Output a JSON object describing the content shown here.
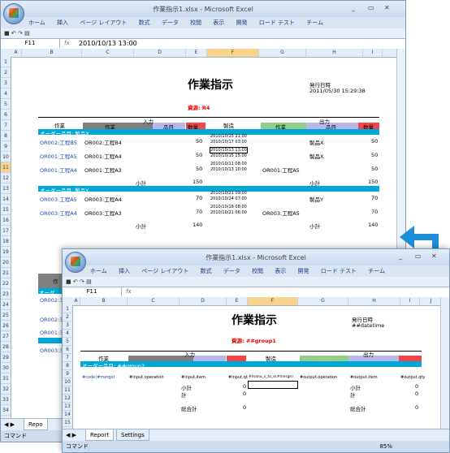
{
  "back": {
    "title": "作業指示1.xlsx - Microsoft Excel",
    "ribbon_tabs": [
      "ホーム",
      "挿入",
      "ページ レイアウト",
      "数式",
      "データ",
      "校閲",
      "表示",
      "開発",
      "ロード テスト",
      "チーム"
    ],
    "namebox": "F11",
    "formula": "2010/10/13 13:00",
    "columns": [
      "A",
      "B",
      "C",
      "D",
      "E",
      "F",
      "G",
      "H",
      "I"
    ],
    "rows": [
      "1",
      "2",
      "3",
      "4",
      "5",
      "6",
      "7",
      "8",
      "9",
      "10",
      "11",
      "12",
      "13",
      "14",
      "15",
      "16",
      "17",
      "18",
      "19",
      "20",
      "21",
      "22",
      "23",
      "24",
      "25",
      "26",
      "27",
      "28",
      "29",
      "30",
      "31",
      "32",
      "33",
      "34"
    ],
    "doc_title": "作業指示",
    "issue_label": "発行日時",
    "issue_value": "2011/05/30 15:29:38",
    "resource": "資源: R4",
    "hdr_work": "作業",
    "hdr_input": "入力",
    "hdr_make": "製造",
    "hdr_output": "出力",
    "sub_work": "作業",
    "sub_item": "品目",
    "sub_qty": "数量",
    "group1": "オーダー品目: 製品X",
    "group2": "オーダー品目: 製品Y",
    "rows_data": [
      {
        "op": "OR002:工程B5",
        "in": "OR002:工程B4",
        "qty": "50",
        "t1": "2010/10/15 21:00",
        "t2": "2010/10/17 03:00",
        "outop": "",
        "out": "製品X",
        "oqty": "50"
      },
      {
        "op": "OR001:工程A5",
        "in": "OR001:工程A4",
        "qty": "50",
        "t1": "2010/10/13 13:00",
        "t2": "2010/10/15 15:00",
        "outop": "",
        "out": "製品X",
        "oqty": "50"
      },
      {
        "op": "OR001:工程A4",
        "in": "OR001:工程A3",
        "qty": "50",
        "t1": "2010/10/11 08:00",
        "t2": "2010/10/13 10:00",
        "outop": "OR001:工程A5",
        "out": "",
        "oqty": "50"
      }
    ],
    "subtotal1_label": "小計",
    "subtotal1": "150",
    "subtotal1_out": "150",
    "rows_data2": [
      {
        "op": "OR003:工程A5",
        "in": "OR003:工程A4",
        "qty": "70",
        "t1": "2010/10/21 09:00",
        "t2": "2010/10/24 07:00",
        "outop": "",
        "out": "製品Y",
        "oqty": "70"
      },
      {
        "op": "OR003:工程A4",
        "in": "OR003:工程A3",
        "qty": "70",
        "t1": "2010/10/18 08:00",
        "t2": "2010/10/21 06:00",
        "outop": "OR003:工程A5",
        "out": "",
        "oqty": "70"
      }
    ],
    "subtotal2": "140",
    "subtotal2_out": "140",
    "partial_left": [
      "OR002:3",
      "OR002:3",
      "OR001:3",
      "OR003:3"
    ],
    "partial_work": "作",
    "partial_order": "オーダ",
    "tab": "Repo",
    "status": "コマンド"
  },
  "front": {
    "title": "作業指示1.xlsx - Microsoft Excel",
    "ribbon_tabs": [
      "ホーム",
      "挿入",
      "ページ レイアウト",
      "数式",
      "データ",
      "校閲",
      "表示",
      "開発",
      "ロード テスト",
      "チーム"
    ],
    "namebox": "F11",
    "columns": [
      "A",
      "B",
      "C",
      "D",
      "E",
      "F",
      "G",
      "H",
      "I",
      "J"
    ],
    "rows": [
      "1",
      "2",
      "3",
      "4",
      "5",
      "6",
      "7",
      "8",
      "9",
      "10",
      "11",
      "12",
      "13",
      "14",
      "15"
    ],
    "doc_title": "作業指示",
    "issue_label": "発行日時",
    "issue_value": "##datetime",
    "resource": "資源: ##group1",
    "hdr_work": "作業",
    "hdr_input": "入力",
    "hdr_make": "製造",
    "hdr_output": "出力",
    "group": "オーダー品目: ##group2",
    "r10": [
      "#code(#merge)",
      "#input.operation",
      "#input.item",
      "#input.qty",
      "#manu_s_to_e(#merge)",
      "#output.operation",
      "#output.item",
      "#output.qty"
    ],
    "subtotal": "小計",
    "total": "計",
    "grand": "総合計",
    "zero": "0",
    "tabs": [
      "Report",
      "Settings"
    ],
    "status": "コマンド",
    "zoom": "85%"
  },
  "colors": {
    "cyan": "#00a8d8",
    "gray": "#808080",
    "green": "#92cd8a",
    "blue": "#b7b7e8",
    "red": "#f04848",
    "arrow": "#1d8fd8"
  }
}
